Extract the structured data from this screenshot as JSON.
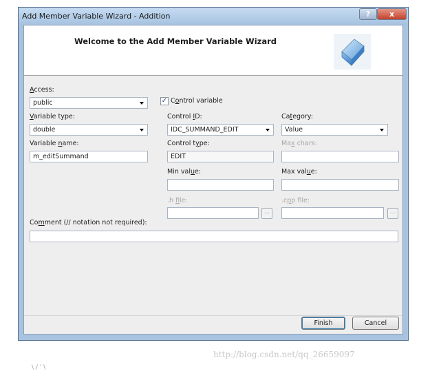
{
  "window": {
    "title": "Add Member Variable Wizard - Addition",
    "help_label": "?",
    "close_label": "x"
  },
  "header": {
    "welcome": "Welcome to the Add Member Variable Wizard",
    "logo_icon": "cube-icon"
  },
  "form": {
    "access": {
      "label_prefix": "",
      "label_accel": "A",
      "label_rest": "ccess:",
      "value": "public"
    },
    "control_variable": {
      "checked": true,
      "checkbox_mark": "✓",
      "label_prefix": "C",
      "label_accel": "o",
      "label_rest": "ntrol variable"
    },
    "variable_type": {
      "label_prefix": "",
      "label_accel": "V",
      "label_rest": "ariable type:",
      "value": "double"
    },
    "variable_name": {
      "label_prefix": "Variable ",
      "label_accel": "n",
      "label_rest": "ame:",
      "value": "m_editSummand"
    },
    "control_id": {
      "label_prefix": "Control ",
      "label_accel": "I",
      "label_rest": "D:",
      "value": "IDC_SUMMAND_EDIT"
    },
    "category": {
      "label_prefix": "Ca",
      "label_accel": "t",
      "label_rest": "egory:",
      "value": "Value"
    },
    "control_type": {
      "label_prefix": "Control t",
      "label_accel": "y",
      "label_rest": "pe:",
      "value": "EDIT"
    },
    "max_chars": {
      "label_prefix": "Ma",
      "label_accel": "x",
      "label_rest": " chars:",
      "value": ""
    },
    "min_value": {
      "label_prefix": "Min val",
      "label_accel": "u",
      "label_rest": "e:",
      "value": ""
    },
    "max_value": {
      "label_prefix": "Max val",
      "label_accel": "u",
      "label_rest": "e:",
      "value": ""
    },
    "h_file": {
      "label_prefix": ".h ",
      "label_accel": "f",
      "label_rest": "ile:",
      "value": "",
      "browse_label": "..."
    },
    "cpp_file": {
      "label_prefix": ".c",
      "label_accel": "p",
      "label_rest": "p file:",
      "value": "",
      "browse_label": "..."
    },
    "comment": {
      "label_prefix": "Co",
      "label_accel": "m",
      "label_rest": "ment (// notation not required):",
      "value": ""
    }
  },
  "buttons": {
    "finish": "Finish",
    "cancel": "Cancel"
  },
  "watermark": "http://blog.csdn.net/qq_26659097",
  "trailing_text": "\\ / ' \\"
}
